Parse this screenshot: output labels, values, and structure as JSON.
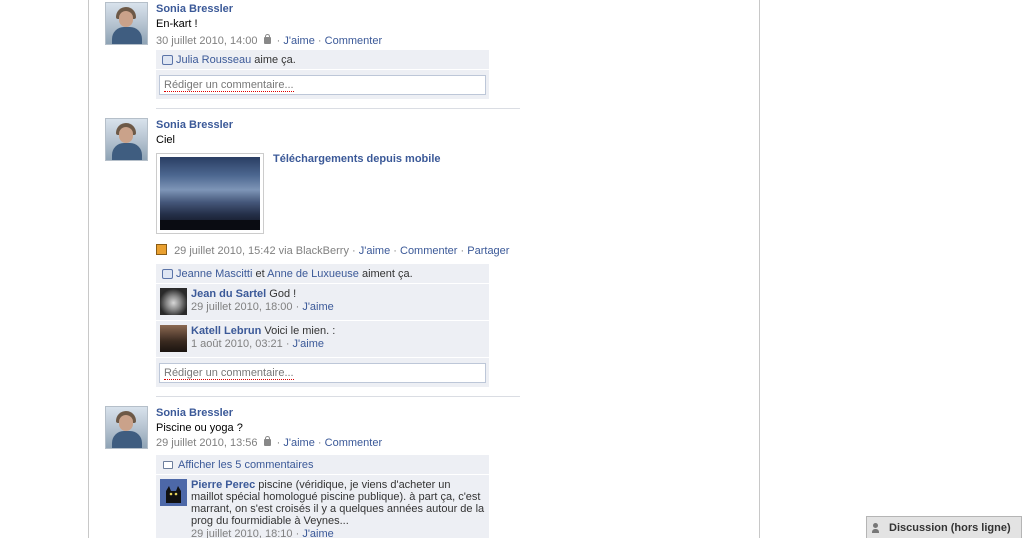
{
  "stories": [
    {
      "author": "Sonia Bressler",
      "message": "En-kart !",
      "date": "30 juillet 2010, 14:00",
      "like": "J'aime",
      "comment": "Commenter",
      "likes_name": "Julia Rousseau",
      "likes_text": "aime ça.",
      "input_placeholder": "Rédiger un commentaire..."
    },
    {
      "author": "Sonia Bressler",
      "message": "Ciel",
      "album_title": "Téléchargements depuis mobile",
      "date": "29 juillet 2010, 15:42 via BlackBerry",
      "like": "J'aime",
      "comment": "Commenter",
      "share": "Partager",
      "likes_name1": "Jeanne Mascitti",
      "likes_and": "et",
      "likes_name2": "Anne de Luxueuse",
      "likes_text": "aiment ça.",
      "comments": [
        {
          "name": "Jean du Sartel",
          "text": "God !",
          "date": "29 juillet 2010, 18:00",
          "like": "J'aime"
        },
        {
          "name": "Katell Lebrun",
          "text": "Voici le mien. :",
          "date": "1 août 2010, 03:21",
          "like": "J'aime"
        }
      ],
      "input_placeholder": "Rédiger un commentaire..."
    },
    {
      "author": "Sonia Bressler",
      "message": "Piscine ou yoga ?",
      "date": "29 juillet 2010, 13:56",
      "like": "J'aime",
      "comment": "Commenter",
      "show_all": "Afficher les 5 commentaires",
      "comments": [
        {
          "name": "Pierre Perec",
          "text": "piscine (véridique, je viens d'acheter un maillot spécial homologué piscine publique). à part ça, c'est marrant, on s'est croisés il y a quelques années autour de la prog du fourmidiable à Veynes...",
          "date": "29 juillet 2010, 18:10",
          "like": "J'aime"
        }
      ]
    }
  ],
  "chat": {
    "label": "Discussion (hors ligne)"
  },
  "separator": "·",
  "colors": {
    "link": "#3b5998",
    "comment_bg": "#edeff4"
  }
}
